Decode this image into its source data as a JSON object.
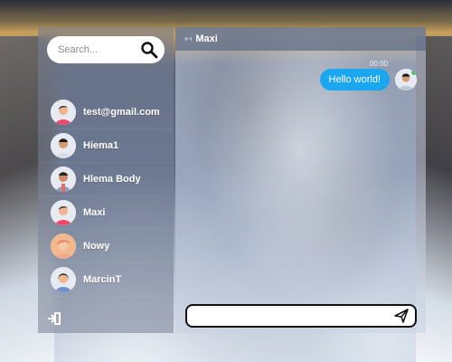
{
  "search": {
    "placeholder": "Search..."
  },
  "contacts": [
    {
      "name": "test@gmail.com"
    },
    {
      "name": "Hiema1"
    },
    {
      "name": "Hlema Body"
    },
    {
      "name": "Maxi"
    },
    {
      "name": "Nowy"
    },
    {
      "name": "MarcinT"
    }
  ],
  "chat": {
    "title": "Maxi",
    "back_icon": "arrow-left-icon",
    "messages": [
      {
        "time": "00:00",
        "text": "Hello world!"
      }
    ],
    "composer": {
      "value": ""
    }
  },
  "colors": {
    "bubble": "#1aa7f0",
    "online": "#35c759"
  }
}
